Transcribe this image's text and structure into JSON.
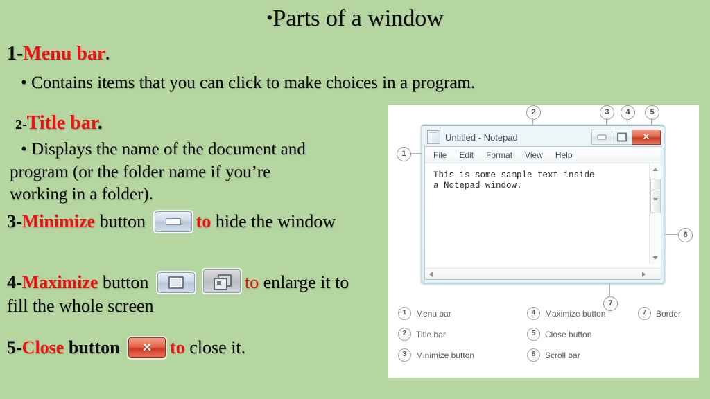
{
  "slide": {
    "background_color": "#b6d6a1",
    "title": "Parts of a window",
    "title_bullet": "•"
  },
  "content": {
    "item1": {
      "number": "1-",
      "term": "Menu bar",
      "period": ".",
      "bullet": "•",
      "description": "Contains items that you can click to make choices in a program."
    },
    "item2": {
      "number": "2-",
      "term": "Title bar",
      "period": ".",
      "bullet": "•",
      "desc_line1": "Displays the name of the document and",
      "desc_line2": "program (or the folder name if you’re",
      "desc_line3": "working in a folder)."
    },
    "item3": {
      "number": "3-",
      "term": "Minimize",
      "label": " button ",
      "icon": "minimize-button-icon",
      "connector": "to",
      "tail": " hide the window"
    },
    "item4": {
      "number": "4-",
      "term": "Maximize",
      "label": " button ",
      "icon_a": "maximize-button-icon",
      "icon_b": "restore-button-icon",
      "connector": "to",
      "tail": " enlarge it to",
      "tail_line2": "fill the whole screen"
    },
    "item5": {
      "number": "5-",
      "term": "Close",
      "label": " button ",
      "icon": "close-button-icon",
      "connector": "to",
      "tail": " close it."
    },
    "accent_red": "#ef1111",
    "text_black": "#0a0a0a"
  },
  "figure": {
    "notepad": {
      "title": "Untitled - Notepad",
      "menu_items": [
        "File",
        "Edit",
        "Format",
        "View",
        "Help"
      ],
      "text_line1": "This is some sample text inside",
      "text_line2": "a Notepad window.",
      "minimize_glyph": "–",
      "maximize_glyph": "□",
      "close_glyph": "×"
    },
    "callouts": [
      {
        "id": "1",
        "target": "menu-bar"
      },
      {
        "id": "2",
        "target": "title-bar"
      },
      {
        "id": "3",
        "target": "minimize-button"
      },
      {
        "id": "4",
        "target": "maximize-button"
      },
      {
        "id": "5",
        "target": "close-button"
      },
      {
        "id": "6",
        "target": "scroll-bar"
      },
      {
        "id": "7",
        "target": "border"
      }
    ],
    "legend": [
      {
        "num": "1",
        "label": "Menu bar"
      },
      {
        "num": "2",
        "label": "Title bar"
      },
      {
        "num": "3",
        "label": "Minimize button"
      },
      {
        "num": "4",
        "label": "Maximize button"
      },
      {
        "num": "5",
        "label": "Close button"
      },
      {
        "num": "6",
        "label": "Scroll bar"
      },
      {
        "num": "7",
        "label": "Border"
      }
    ]
  }
}
